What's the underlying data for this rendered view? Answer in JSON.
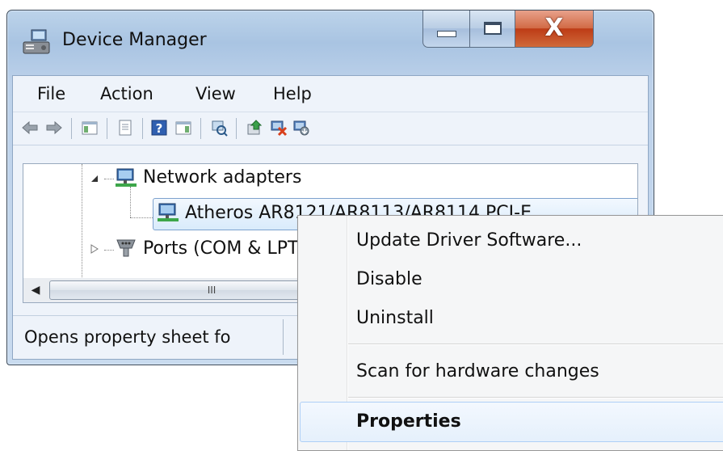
{
  "window": {
    "title": "Device Manager",
    "icons": {
      "app": "device-manager-icon",
      "minimize": "minimize-icon",
      "maximize": "maximize-icon",
      "close": "close-icon"
    }
  },
  "menubar": {
    "items": [
      "File",
      "Action",
      "View",
      "Help"
    ]
  },
  "toolbar": {
    "buttons": [
      "back-icon",
      "forward-icon",
      "show-hide-console-tree-icon",
      "properties-icon",
      "help-icon",
      "action-pane-icon",
      "scan-hardware-icon",
      "update-driver-icon",
      "uninstall-icon",
      "enable-device-icon"
    ]
  },
  "tree": {
    "items": [
      {
        "label": "Network adapters",
        "icon": "network-adapter-icon",
        "expander": "expanded"
      },
      {
        "label": "Atheros AR8121/AR8113/AR8114 PCI-E",
        "icon": "network-adapter-icon",
        "selected": true
      },
      {
        "label": "Ports (COM & LPT)",
        "icon": "port-icon",
        "expander": "collapsed"
      }
    ],
    "scrollbar": {
      "thumb_grip": "III"
    }
  },
  "status": {
    "text": "Opens property sheet fo"
  },
  "context_menu": {
    "items": [
      "Update Driver Software...",
      "Disable",
      "Uninstall",
      "Scan for hardware changes",
      "Properties"
    ],
    "default_item": "Properties"
  },
  "colors": {
    "title_bar": "#bcd3ea",
    "close_button": "#c9431c",
    "selection": "#d9ebfb"
  }
}
